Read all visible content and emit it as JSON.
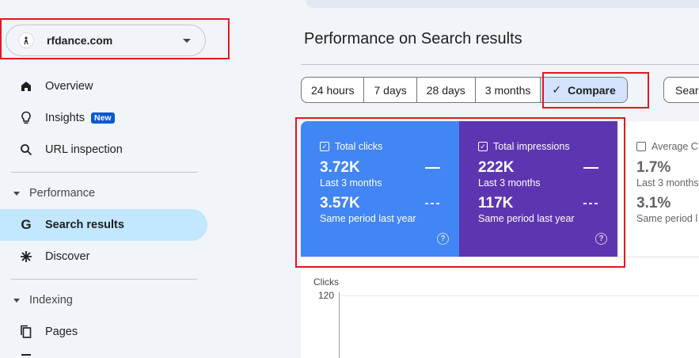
{
  "property": {
    "name": "rfdance.com"
  },
  "sidebar": {
    "items": [
      {
        "label": "Overview"
      },
      {
        "label": "Insights",
        "badge": "New"
      },
      {
        "label": "URL inspection"
      }
    ],
    "performance": {
      "heading": "Performance",
      "items": [
        {
          "label": "Search results"
        },
        {
          "label": "Discover"
        }
      ]
    },
    "indexing": {
      "heading": "Indexing",
      "items": [
        {
          "label": "Pages"
        }
      ]
    }
  },
  "main": {
    "title": "Performance on Search results",
    "ranges": [
      "24 hours",
      "7 days",
      "28 days",
      "3 months"
    ],
    "compare_label": "Compare",
    "search_type_label": "Sear"
  },
  "cards": {
    "clicks": {
      "title": "Total clicks",
      "current_value": "3.72K",
      "current_label": "Last 3 months",
      "previous_value": "3.57K",
      "previous_label": "Same period last year",
      "color": "#4285f4"
    },
    "impressions": {
      "title": "Total impressions",
      "current_value": "222K",
      "current_label": "Last 3 months",
      "previous_value": "117K",
      "previous_label": "Same period last year",
      "color": "#5e35b1"
    },
    "ctr": {
      "title": "Average CT",
      "current_value": "1.7%",
      "current_label": "Last 3 months",
      "previous_value": "3.1%",
      "previous_label": "Same period l"
    }
  },
  "chart": {
    "ylabel": "Clicks",
    "tick_top": "120"
  },
  "colors": {
    "accent": "#0b57d0",
    "highlight": "#e8141f",
    "active_nav": "#c2e7ff"
  }
}
